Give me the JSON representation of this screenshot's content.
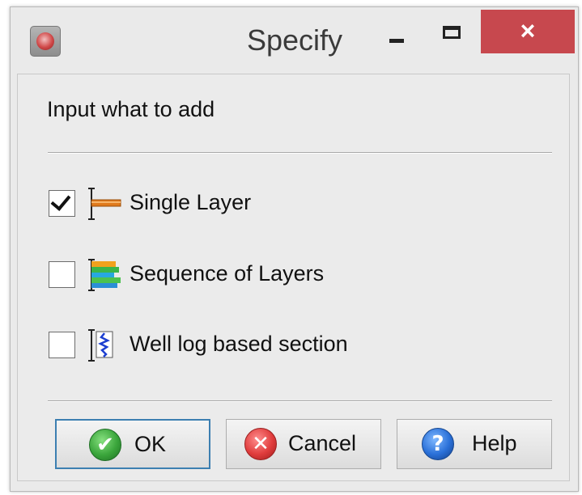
{
  "window": {
    "title": "Specify",
    "controls": {
      "minimize": "−",
      "maximize": "□",
      "close": "×"
    },
    "close_color": "#c7484e"
  },
  "dialog": {
    "prompt": "Input what to add",
    "options": [
      {
        "label": "Single Layer",
        "checked": true,
        "icon": "single-layer-icon"
      },
      {
        "label": "Sequence of Layers",
        "checked": false,
        "icon": "sequence-of-layers-icon"
      },
      {
        "label": "Well log based section",
        "checked": false,
        "icon": "well-log-section-icon"
      }
    ],
    "buttons": {
      "ok": {
        "label": "OK",
        "icon": "ok-check-icon",
        "glyph": "✔"
      },
      "cancel": {
        "label": "Cancel",
        "icon": "cancel-x-icon",
        "glyph": "✕"
      },
      "help": {
        "label": "Help",
        "icon": "help-question-icon",
        "glyph": "?"
      }
    }
  }
}
